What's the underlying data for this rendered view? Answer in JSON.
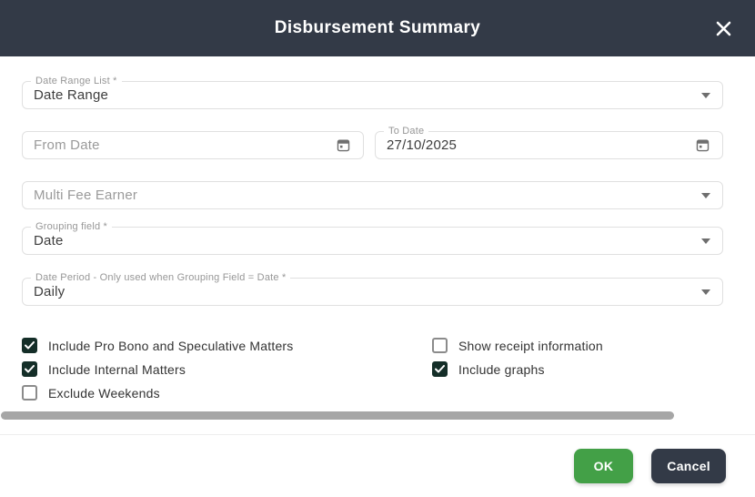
{
  "dialog": {
    "title": "Disbursement Summary"
  },
  "fields": {
    "date_range_list": {
      "label": "Date Range List *",
      "value": "Date Range"
    },
    "from_date": {
      "placeholder": "From Date",
      "value": ""
    },
    "to_date": {
      "label": "To Date",
      "value": "27/10/2025"
    },
    "multi_fee_earner": {
      "placeholder": "Multi Fee Earner"
    },
    "grouping_field": {
      "label": "Grouping field *",
      "value": "Date"
    },
    "date_period": {
      "label": "Date Period - Only used when Grouping Field = Date *",
      "value": "Daily"
    }
  },
  "checkboxes": {
    "left": [
      {
        "label": "Include Pro Bono and Speculative Matters",
        "checked": true
      },
      {
        "label": "Include Internal Matters",
        "checked": true
      },
      {
        "label": "Exclude Weekends",
        "checked": false
      }
    ],
    "right": [
      {
        "label": "Show receipt information",
        "checked": false
      },
      {
        "label": "Include graphs",
        "checked": true
      }
    ]
  },
  "buttons": {
    "ok": "OK",
    "cancel": "Cancel"
  },
  "icons": {
    "close": "close-x",
    "calendar": "calendar",
    "dropdown": "chevron-down"
  },
  "colors": {
    "header_bg": "#333a47",
    "ok_green": "#43a047",
    "cancel_dark": "#333a47",
    "checkbox_checked": "#142e28",
    "scrollbar_thumb": "#a6a6a6",
    "field_border": "#e0e0e0"
  }
}
